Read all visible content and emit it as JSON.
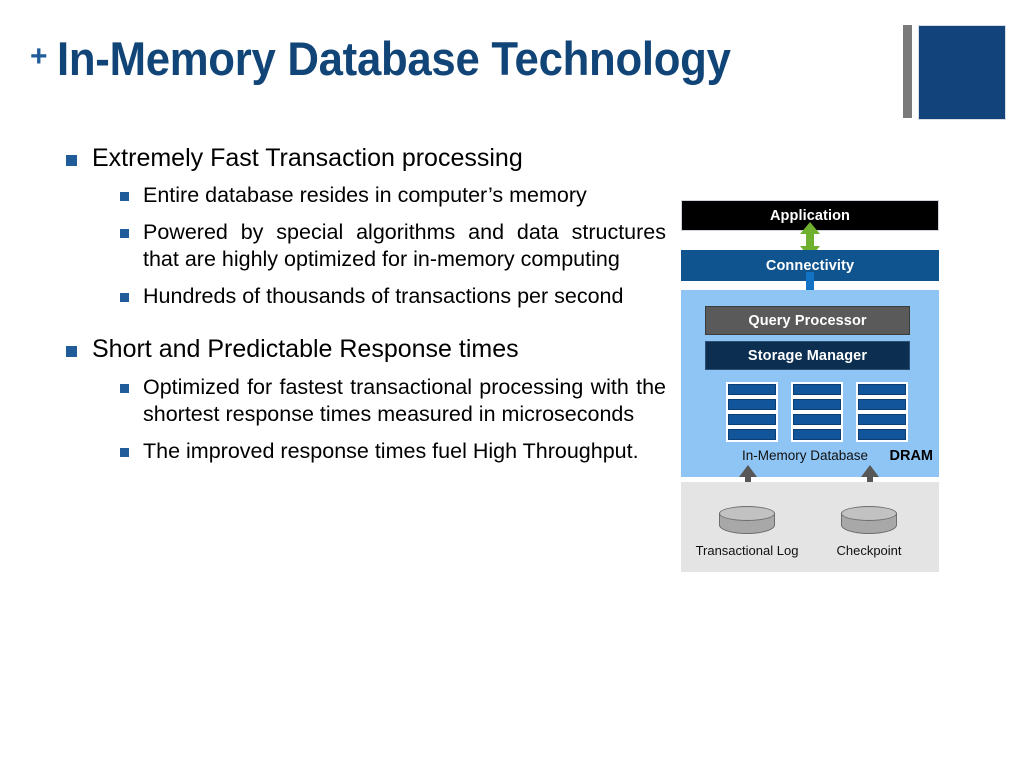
{
  "slide": {
    "title_prefix": "+",
    "title": "In-Memory Database Technology"
  },
  "logo": {
    "bar_name": "gray-accent-bar",
    "block_name": "blue-accent-block",
    "bar_color": "#7A7A7A",
    "block_color": "#12437A"
  },
  "bullets": [
    {
      "level": 1,
      "text": "Extremely Fast Transaction processing",
      "children": [
        {
          "text": "Entire database resides in computer’s memory",
          "justify": false
        },
        {
          "text": "Powered by special algorithms and data structures that are highly optimized for  in-memory computing",
          "justify": true
        },
        {
          "text": "Hundreds of thousands of transactions per second",
          "justify": true
        }
      ]
    },
    {
      "level": 1,
      "text": "Short and Predictable Response times",
      "children": [
        {
          "text": "Optimized for fastest transactional processing with the shortest response    times measured in microseconds",
          "justify": true
        },
        {
          "text": "The improved response times fuel High Throughput.",
          "justify": true
        }
      ]
    }
  ],
  "diagram": {
    "name": "in-memory-database-architecture",
    "application": {
      "label": "Application",
      "color": "#000000"
    },
    "connectivity": {
      "label": "Connectivity",
      "color": "#10548F"
    },
    "dram": {
      "region_label": "DRAM",
      "region_color": "#8FC5F5",
      "query_processor": {
        "label": "Query Processor",
        "color": "#5A5A5A"
      },
      "storage_manager": {
        "label": "Storage Manager",
        "color": "#0B2E51"
      },
      "memory_label": "In-Memory Database",
      "memory_columns": 3,
      "memory_bars_per_column": 4,
      "memory_bar_color": "#13559B"
    },
    "disk": {
      "region_color": "#E4E4E4",
      "stores": [
        {
          "label": "Transactional Log"
        },
        {
          "label": "Checkpoint"
        }
      ]
    },
    "arrows": [
      {
        "name": "application-connectivity-arrow",
        "color": "#6FB02F",
        "direction": "both"
      },
      {
        "name": "connectivity-dram-arrow",
        "color": "#1272C4",
        "direction": "down"
      },
      {
        "name": "dram-transactional-log-arrow",
        "color": "#575757",
        "direction": "both"
      },
      {
        "name": "dram-checkpoint-arrow",
        "color": "#575757",
        "direction": "both"
      }
    ]
  }
}
